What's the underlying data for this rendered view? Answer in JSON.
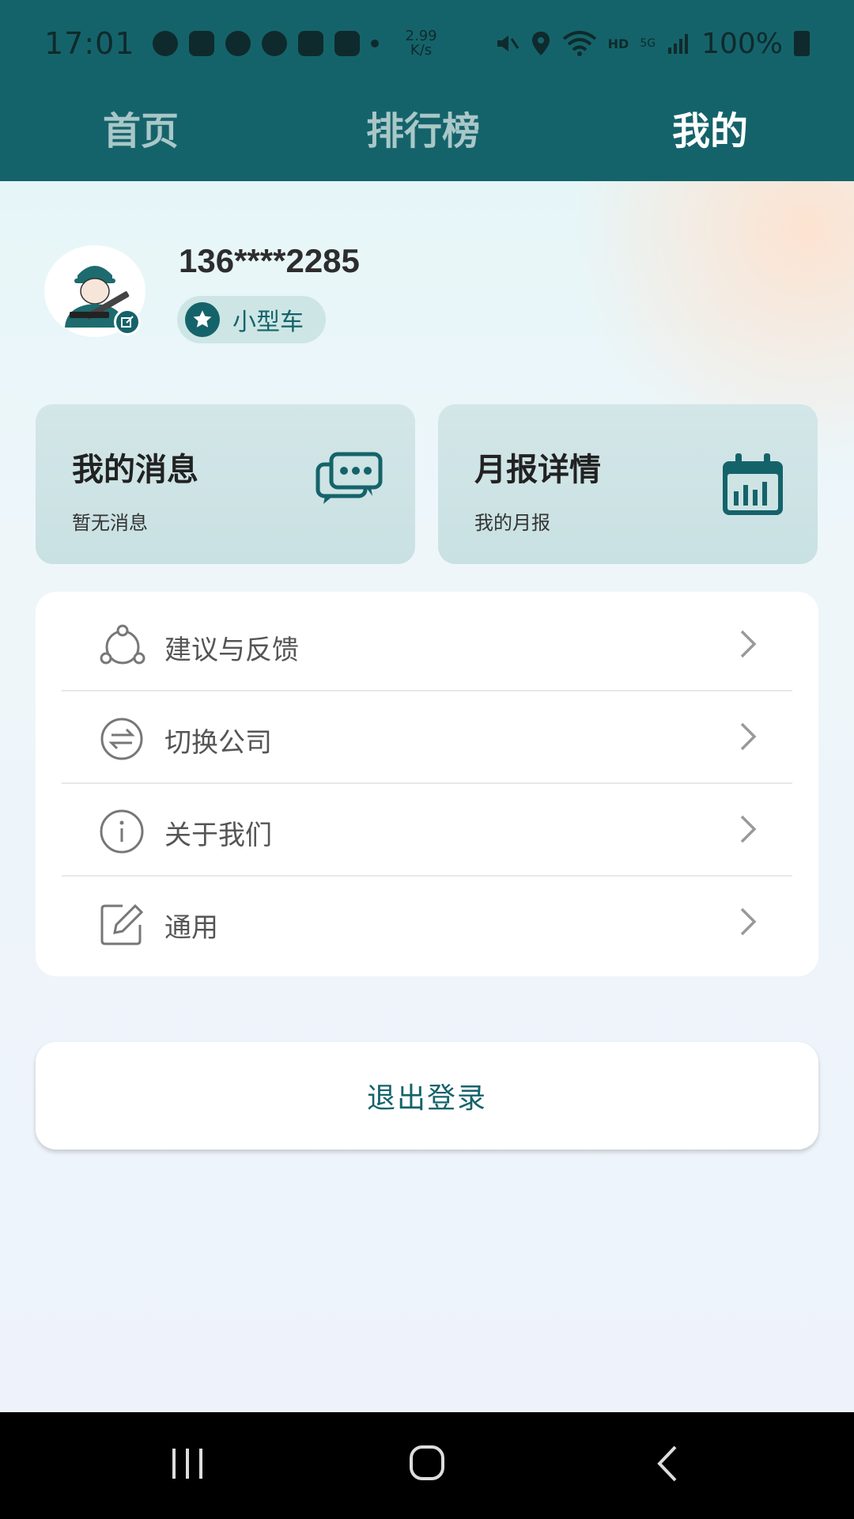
{
  "status_bar": {
    "time": "17:01",
    "speed_top": "2.99",
    "speed_bottom": "K/s",
    "hd": "HD",
    "network": "5G",
    "battery": "100%"
  },
  "tabs": [
    {
      "label": "首页",
      "active": false
    },
    {
      "label": "排行榜",
      "active": false
    },
    {
      "label": "我的",
      "active": true
    }
  ],
  "profile": {
    "phone": "136****2285",
    "badge_label": "小型车"
  },
  "cards": [
    {
      "title": "我的消息",
      "subtitle": "暂无消息",
      "icon": "chat-bubbles-icon"
    },
    {
      "title": "月报详情",
      "subtitle": "我的月报",
      "icon": "calendar-chart-icon"
    }
  ],
  "menu": [
    {
      "label": "建议与反馈",
      "icon": "feedback-icon"
    },
    {
      "label": "切换公司",
      "icon": "switch-icon"
    },
    {
      "label": "关于我们",
      "icon": "info-icon"
    },
    {
      "label": "通用",
      "icon": "edit-icon"
    }
  ],
  "logout_label": "退出登录",
  "colors": {
    "primary": "#15636a",
    "tab_inactive": "#a9c7c8",
    "card_bg": "#cde3e4"
  }
}
